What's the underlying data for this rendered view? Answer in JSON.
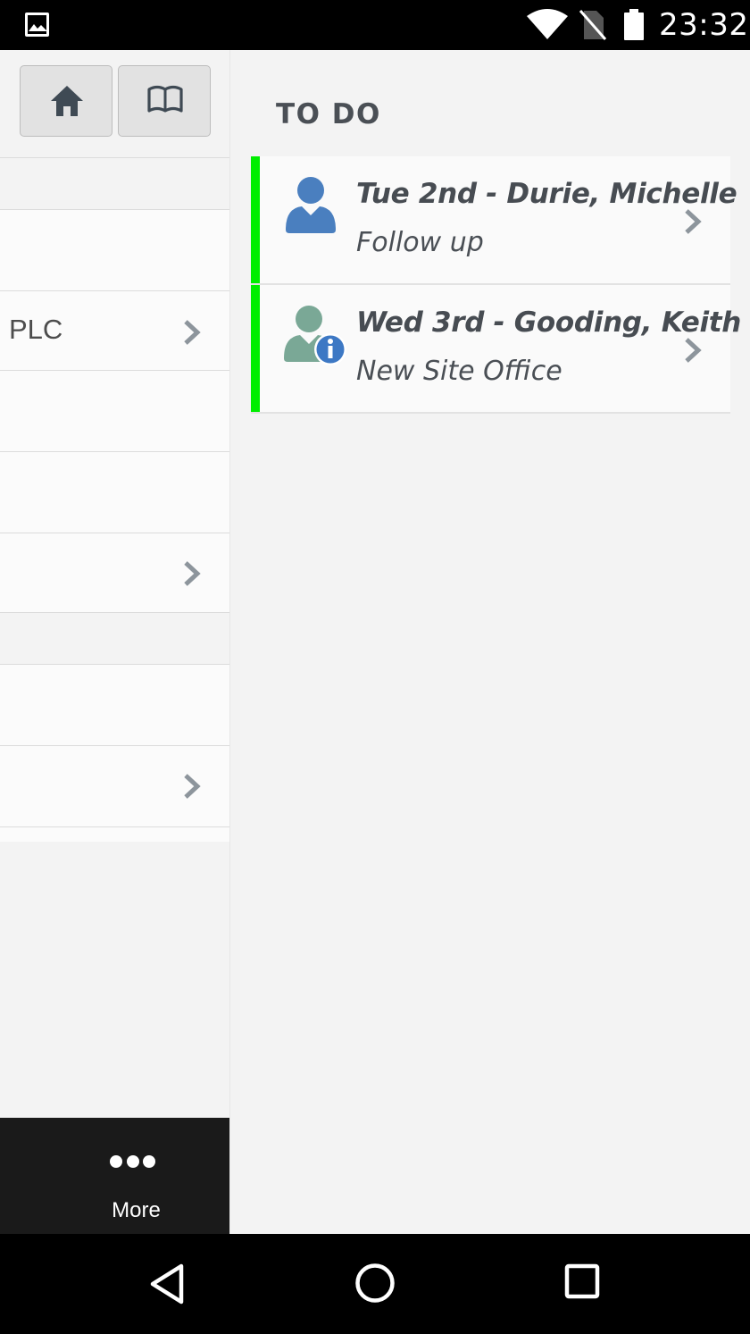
{
  "status_bar": {
    "time": "23:32",
    "icons": [
      "gallery-icon",
      "wifi-icon",
      "no-sim-icon",
      "battery-icon"
    ]
  },
  "toolbar": {
    "buttons": [
      "home-icon",
      "book-icon"
    ]
  },
  "left_list": {
    "rows": [
      {
        "label": "",
        "chevron": false
      },
      {
        "label": "PLC",
        "chevron": true
      },
      {
        "label": "",
        "chevron": false
      },
      {
        "label": "",
        "chevron": false
      },
      {
        "label": "",
        "chevron": true
      },
      {
        "label": "",
        "chevron": false
      },
      {
        "label": "",
        "chevron": true
      }
    ]
  },
  "more_bar": {
    "label": "More",
    "icon": "ellipsis-icon"
  },
  "todo": {
    "title": "TO DO",
    "accent_color": "#00ee00",
    "items": [
      {
        "title": "Tue 2nd - Durie, Michelle",
        "subtitle": "Follow up",
        "icon": "person-icon"
      },
      {
        "title": "Wed 3rd - Gooding, Keith",
        "subtitle": "New Site Office",
        "icon": "person-info-icon"
      }
    ]
  },
  "nav_bar": {
    "buttons": [
      "back-icon",
      "home-circle-icon",
      "recents-icon"
    ]
  }
}
